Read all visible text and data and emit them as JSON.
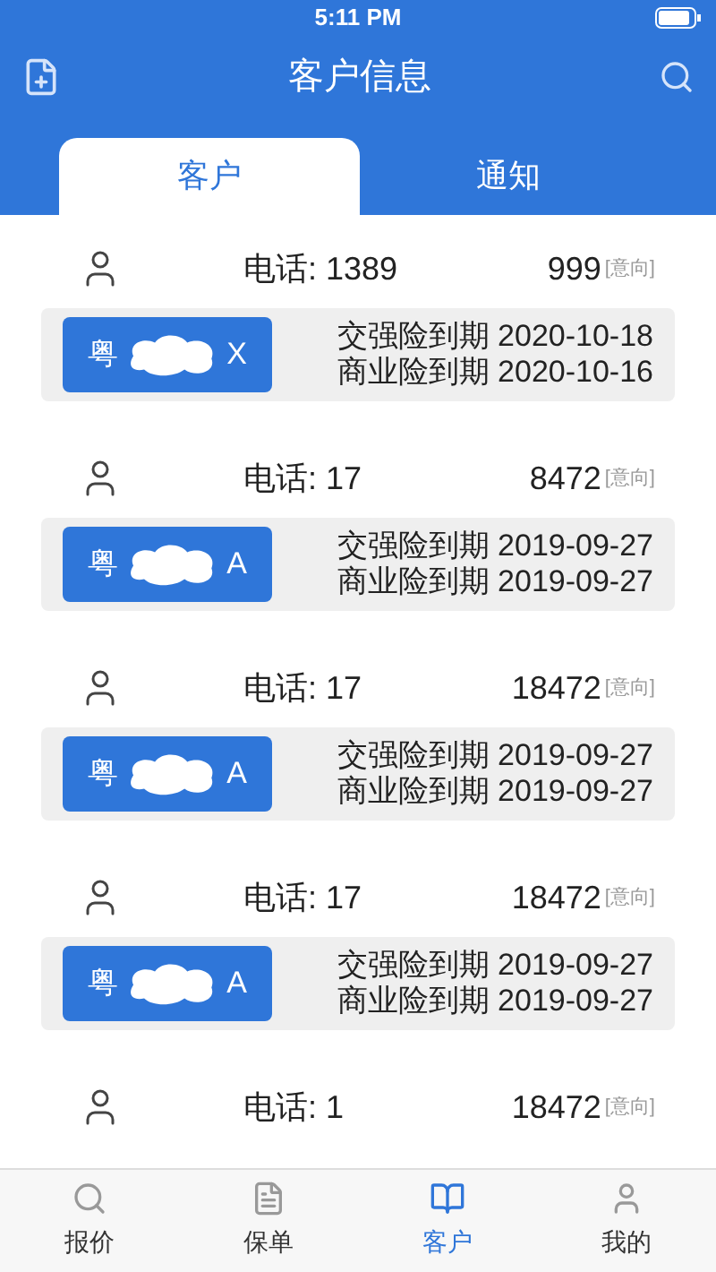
{
  "status_bar": {
    "time": "5:11 PM"
  },
  "header": {
    "title": "客户信息"
  },
  "tabs": [
    {
      "label": "客户",
      "selected": true
    },
    {
      "label": "通知",
      "selected": false
    }
  ],
  "customers": [
    {
      "phone_start": "电话: 1389",
      "phone_end": "999",
      "tag": "[意向]",
      "card": {
        "plate_start": "粤",
        "plate_end": "X",
        "lines": [
          "交强险到期 2020-10-18",
          "商业险到期 2020-10-16"
        ]
      }
    },
    {
      "phone_start": "电话: 17",
      "phone_end": "8472",
      "tag": "[意向]",
      "card": {
        "plate_start": "粤",
        "plate_end": "A",
        "lines": [
          "交强险到期 2019-09-27",
          "商业险到期 2019-09-27"
        ]
      }
    },
    {
      "phone_start": "电话: 17",
      "phone_end": "18472",
      "tag": "[意向]",
      "card": {
        "plate_start": "粤",
        "plate_end": "A",
        "lines": [
          "交强险到期 2019-09-27",
          "商业险到期 2019-09-27"
        ]
      }
    },
    {
      "phone_start": "电话: 17",
      "phone_end": "18472",
      "tag": "[意向]",
      "card": {
        "plate_start": "粤",
        "plate_end": "A",
        "lines": [
          "交强险到期 2019-09-27",
          "商业险到期 2019-09-27"
        ]
      }
    },
    {
      "phone_start": "电话: 1",
      "phone_end": "18472",
      "tag": "[意向]"
    }
  ],
  "bottom_tabs": [
    {
      "label": "报价",
      "kind": "search",
      "selected": false
    },
    {
      "label": "保单",
      "kind": "doc",
      "selected": false
    },
    {
      "label": "客户",
      "kind": "book",
      "selected": true
    },
    {
      "label": "我的",
      "kind": "person",
      "selected": false
    }
  ]
}
